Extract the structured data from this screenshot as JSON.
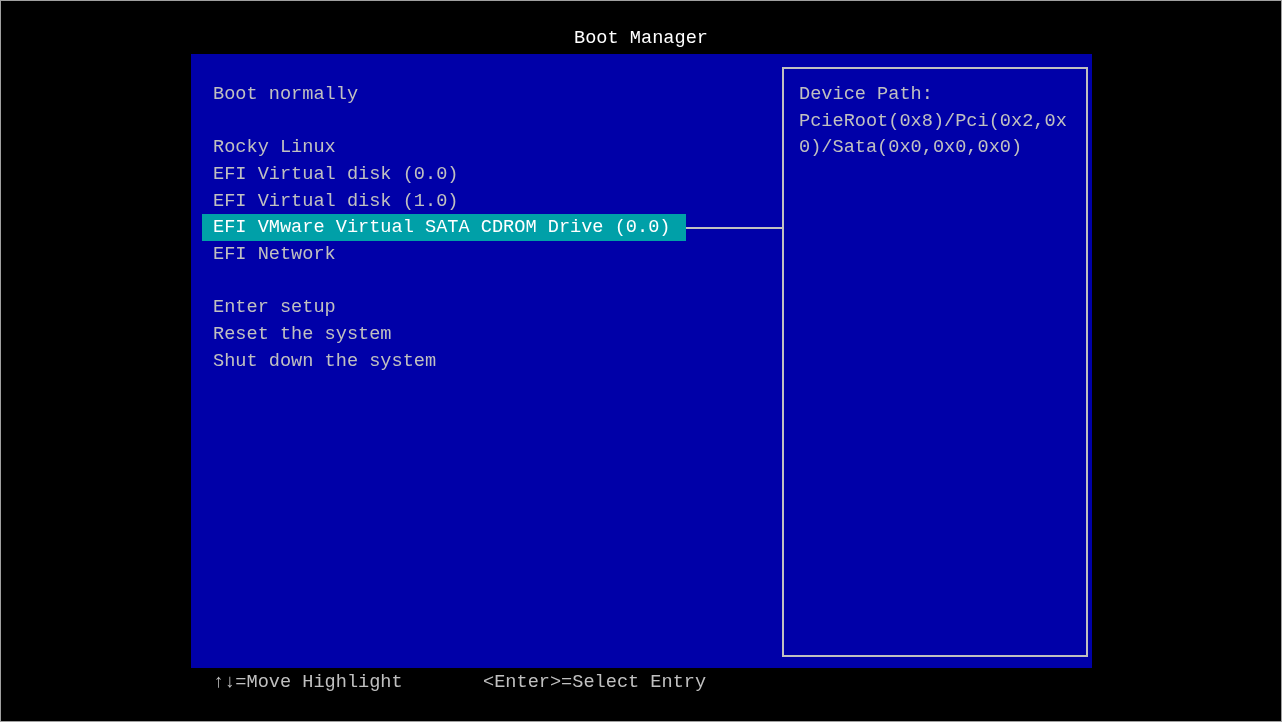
{
  "window": {
    "title": "Boot Manager"
  },
  "menu": {
    "sections": [
      {
        "items": [
          {
            "label": "Boot normally",
            "selected": false
          }
        ]
      },
      {
        "items": [
          {
            "label": "Rocky Linux",
            "selected": false
          },
          {
            "label": "EFI Virtual disk (0.0)",
            "selected": false
          },
          {
            "label": "EFI Virtual disk (1.0)",
            "selected": false
          },
          {
            "label": "EFI VMware Virtual SATA CDROM Drive (0.0)",
            "selected": true
          },
          {
            "label": "EFI Network",
            "selected": false
          }
        ]
      },
      {
        "items": [
          {
            "label": "Enter setup",
            "selected": false
          },
          {
            "label": "Reset the system",
            "selected": false
          },
          {
            "label": "Shut down the system",
            "selected": false
          }
        ]
      }
    ]
  },
  "details": {
    "label": "Device Path:",
    "lines": [
      "PcieRoot(0x8)/Pci(0x2,0x",
      "0)/Sata(0x0,0x0,0x0)"
    ]
  },
  "status_bar": {
    "hints": [
      "↑↓=Move Highlight",
      "<Enter>=Select Entry"
    ]
  }
}
